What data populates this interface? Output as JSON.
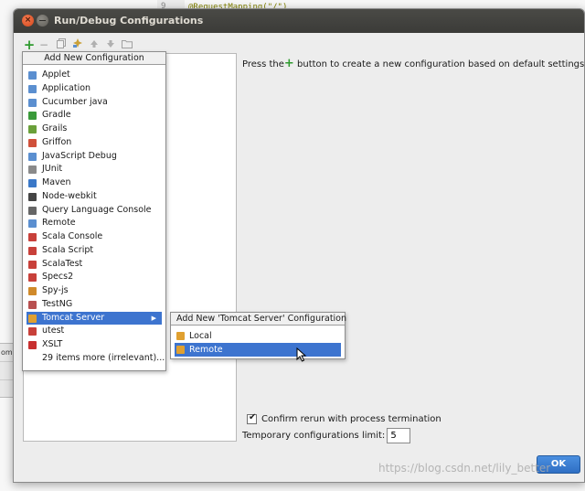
{
  "background": {
    "gutter_number": "9",
    "code_line": "@RequestMapping(\"/\")",
    "left_strip_text": "ome"
  },
  "dialog": {
    "title": "Run/Debug Configurations",
    "hint_before": "Press the",
    "hint_after": " button to create a new configuration based on default settings",
    "confirm_label": "Confirm rerun with process termination",
    "confirm_checked": true,
    "limit_label": "Temporary configurations limit:",
    "limit_value": "5",
    "ok_label": "OK"
  },
  "toolbar": {
    "icons": [
      "add-icon",
      "remove-icon",
      "copy-icon",
      "edit-defaults-icon",
      "move-up-icon",
      "move-down-icon",
      "folder-icon"
    ]
  },
  "popup": {
    "header": "Add New Configuration",
    "items": [
      {
        "label": "Applet",
        "icon": "applet-icon",
        "color": "#5b8fd0"
      },
      {
        "label": "Application",
        "icon": "application-icon",
        "color": "#5b8fd0"
      },
      {
        "label": "Cucumber java",
        "icon": "cucumber-icon",
        "color": "#5b8fd0"
      },
      {
        "label": "Gradle",
        "icon": "gradle-icon",
        "color": "#3a9a3a"
      },
      {
        "label": "Grails",
        "icon": "grails-icon",
        "color": "#6aa03a"
      },
      {
        "label": "Griffon",
        "icon": "griffon-icon",
        "color": "#d0503a"
      },
      {
        "label": "JavaScript Debug",
        "icon": "javascript-debug-icon",
        "color": "#5b8fd0"
      },
      {
        "label": "JUnit",
        "icon": "junit-icon",
        "color": "#8a8a8a"
      },
      {
        "label": "Maven",
        "icon": "maven-icon",
        "color": "#3a78c8"
      },
      {
        "label": "Node-webkit",
        "icon": "node-webkit-icon",
        "color": "#444444"
      },
      {
        "label": "Query Language Console",
        "icon": "query-console-icon",
        "color": "#666666"
      },
      {
        "label": "Remote",
        "icon": "remote-icon",
        "color": "#5b8fd0"
      },
      {
        "label": "Scala Console",
        "icon": "scala-console-icon",
        "color": "#c8403a"
      },
      {
        "label": "Scala Script",
        "icon": "scala-script-icon",
        "color": "#c8403a"
      },
      {
        "label": "ScalaTest",
        "icon": "scalatest-icon",
        "color": "#c8403a"
      },
      {
        "label": "Specs2",
        "icon": "specs2-icon",
        "color": "#c8403a"
      },
      {
        "label": "Spy-js",
        "icon": "spy-js-icon",
        "color": "#d08a2a"
      },
      {
        "label": "TestNG",
        "icon": "testng-icon",
        "color": "#b85050"
      },
      {
        "label": "Tomcat Server",
        "icon": "tomcat-icon",
        "color": "#e0a030",
        "selected": true,
        "submenu": true
      },
      {
        "label": "utest",
        "icon": "utest-icon",
        "color": "#c8403a"
      },
      {
        "label": "XSLT",
        "icon": "xslt-icon",
        "color": "#c83030"
      },
      {
        "label": "29 items more (irrelevant)...",
        "icon": "",
        "color": ""
      }
    ]
  },
  "submenu": {
    "header": "Add New 'Tomcat Server' Configuration",
    "items": [
      {
        "label": "Local",
        "icon": "tomcat-local-icon",
        "color": "#e0a030"
      },
      {
        "label": "Remote",
        "icon": "tomcat-remote-icon",
        "color": "#e0a030",
        "selected": true
      }
    ]
  },
  "watermark": "https://blog.csdn.net/lily_better"
}
